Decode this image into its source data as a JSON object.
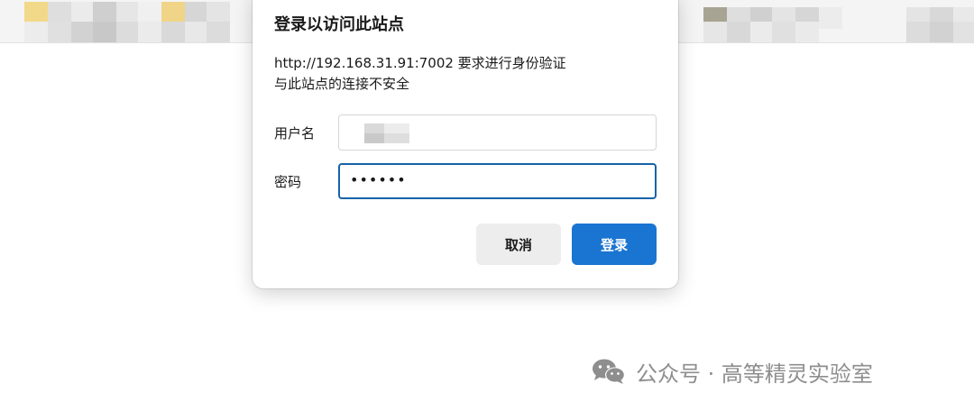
{
  "dialog": {
    "title": "登录以访问此站点",
    "message_line1": "http://192.168.31.91:7002 要求进行身份验证",
    "message_line2": "与此站点的连接不安全",
    "username_label": "用户名",
    "password_label": "密码",
    "password_value": "••••••",
    "cancel_label": "取消",
    "login_label": "登录"
  },
  "colors": {
    "accent": "#1a74d1",
    "focus_border": "#1663a8"
  },
  "watermark": {
    "icon": "wechat-icon",
    "text": "公众号 · 高等精灵实验室"
  }
}
